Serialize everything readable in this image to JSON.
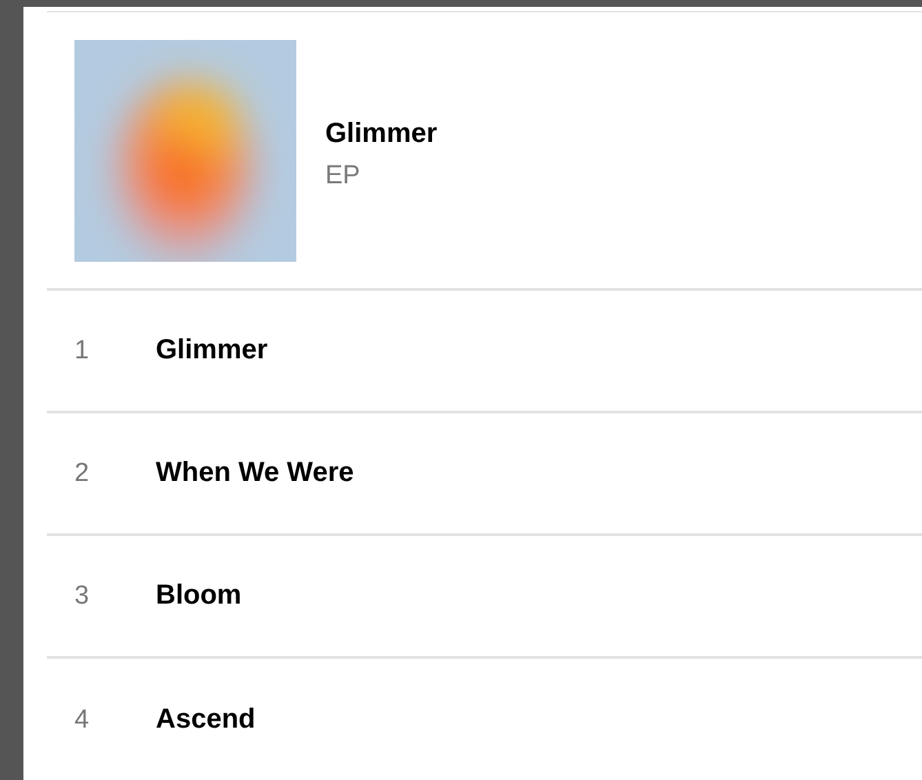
{
  "album": {
    "title": "Glimmer",
    "type": "EP"
  },
  "tracks": [
    {
      "number": "1",
      "title": "Glimmer"
    },
    {
      "number": "2",
      "title": "When We Were"
    },
    {
      "number": "3",
      "title": "Bloom"
    },
    {
      "number": "4",
      "title": "Ascend"
    }
  ]
}
